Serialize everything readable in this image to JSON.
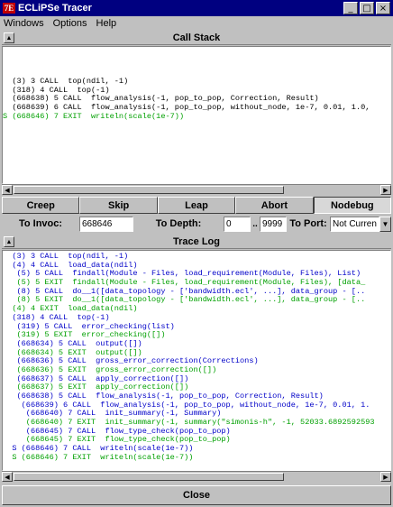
{
  "window": {
    "logo": "7E",
    "title": "ECLiPSe Tracer",
    "controls": [
      "_",
      "□",
      "×"
    ]
  },
  "menu": {
    "windows": "Windows",
    "options": "Options",
    "help": "Help"
  },
  "call_stack": {
    "header": "Call Stack",
    "lines": [
      {
        "text": "  (3) 3 CALL  top(ndil, -1)",
        "color": "black"
      },
      {
        "text": "  (318) 4 CALL  top(-1)",
        "color": "black"
      },
      {
        "text": "  (668638) 5 CALL  flow_analysis(-1, pop_to_pop, Correction, Result)",
        "color": "black"
      },
      {
        "text": "  (668639) 6 CALL  flow_analysis(-1, pop_to_pop, without_node, 1e-7, 0.01, 1.0,",
        "color": "black"
      },
      {
        "text": "S (668646) 7 EXIT  writeln(scale(1e-7))",
        "color": "green"
      }
    ]
  },
  "buttons": {
    "creep": "Creep",
    "skip": "Skip",
    "leap": "Leap",
    "abort": "Abort",
    "nodebug": "Nodebug"
  },
  "controls": {
    "to_invoc_label": "To Invoc:",
    "to_invoc_value": "668646",
    "to_depth_label": "To Depth:",
    "depth_from": "0",
    "depth_sep": "..",
    "depth_to": "9999",
    "to_port_label": "To Port:",
    "to_port_value": "Not Curren"
  },
  "trace_log": {
    "header": "Trace Log",
    "lines": [
      {
        "text": "  (3) 3 CALL  top(ndil, -1)",
        "color": "blue"
      },
      {
        "text": "  (4) 4 CALL  load_data(ndil)",
        "color": "blue"
      },
      {
        "text": "   (5) 5 CALL  findall(Module - Files, load_requirement(Module, Files), List)",
        "color": "blue"
      },
      {
        "text": "   (5) 5 EXIT  findall(Module - Files, load_requirement(Module, Files), [data_",
        "color": "green"
      },
      {
        "text": "   (8) 5 CALL  do__1([data_topology - ['bandwidth.ecl', ...], data_group - [..",
        "color": "blue"
      },
      {
        "text": "   (8) 5 EXIT  do__1([data_topology - ['bandwidth.ecl', ...], data_group - [..",
        "color": "green"
      },
      {
        "text": "  (4) 4 EXIT  load_data(ndil)",
        "color": "green"
      },
      {
        "text": "  (318) 4 CALL  top(-1)",
        "color": "blue"
      },
      {
        "text": "   (319) 5 CALL  error_checking(list)",
        "color": "blue"
      },
      {
        "text": "   (319) 5 EXIT  error_checking([])",
        "color": "green"
      },
      {
        "text": "   (668634) 5 CALL  output([])",
        "color": "blue"
      },
      {
        "text": "   (668634) 5 EXIT  output([])",
        "color": "green"
      },
      {
        "text": "   (668636) 5 CALL  gross_error_correction(Corrections)",
        "color": "blue"
      },
      {
        "text": "   (668636) 5 EXIT  gross_error_correction([])",
        "color": "green"
      },
      {
        "text": "   (668637) 5 CALL  apply_correction([])",
        "color": "blue"
      },
      {
        "text": "   (668637) 5 EXIT  apply_correction([])",
        "color": "green"
      },
      {
        "text": "   (668638) 5 CALL  flow_analysis(-1, pop_to_pop, Correction, Result)",
        "color": "blue"
      },
      {
        "text": "    (668639) 6 CALL  flow_analysis(-1, pop_to_pop, without_node, 1e-7, 0.01, 1.",
        "color": "blue"
      },
      {
        "text": "     (668640) 7 CALL  init_summary(-1, Summary)",
        "color": "blue"
      },
      {
        "text": "     (668640) 7 EXIT  init_summary(-1, summary(\"simonis-h\", -1, 52033.6892592593",
        "color": "green"
      },
      {
        "text": "     (668645) 7 CALL  flow_type_check(pop_to_pop)",
        "color": "blue"
      },
      {
        "text": "     (668645) 7 EXIT  flow_type_check(pop_to_pop)",
        "color": "green"
      },
      {
        "text": "  S (668646) 7 CALL  writeln(scale(1e-7))",
        "color": "blue"
      },
      {
        "text": "  S (668646) 7 EXIT  writeln(scale(1e-7))",
        "color": "green"
      }
    ]
  },
  "close_label": "Close",
  "icons": {
    "collapse": "up-triangle-icon",
    "scroll_left": "left-arrow-icon",
    "scroll_right": "right-arrow-icon",
    "dropdown": "down-arrow-icon"
  }
}
